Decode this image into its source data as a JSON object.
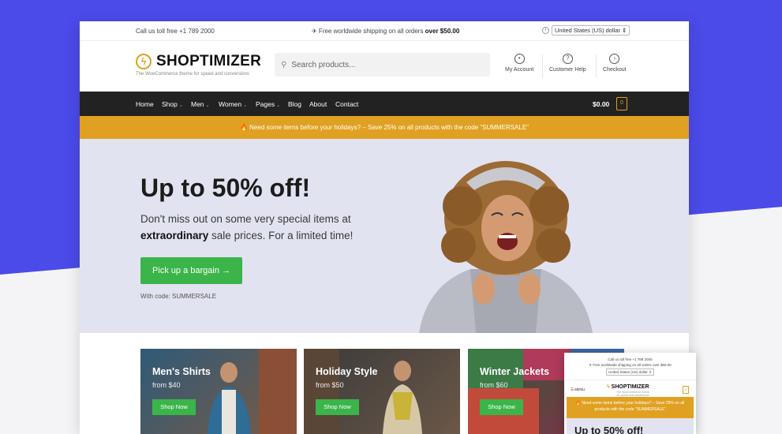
{
  "colors": {
    "brand_blue": "#4a4be8",
    "accent": "#e0a021",
    "green": "#3bb54a",
    "nav_bg": "#222222",
    "hero_bg": "#e2e3f0"
  },
  "topbar": {
    "phone": "Call us toll free +1 789 2000",
    "shipping_prefix": "✈ Free worldwide shipping on all orders ",
    "shipping_amount": "over $50.00",
    "currency": "United States (US) dollar ⇕"
  },
  "header": {
    "logo_text": "SHOPTIMIZER",
    "tagline": "The WooCommerce theme for speed and conversions",
    "search_placeholder": "Search products...",
    "links": {
      "account": "My Account",
      "help": "Customer Help",
      "checkout": "Checkout"
    }
  },
  "nav": {
    "items": [
      "Home",
      "Shop",
      "Men",
      "Women",
      "Pages",
      "Blog",
      "About",
      "Contact"
    ],
    "cart_total": "$0.00",
    "cart_count": "0"
  },
  "promo": "🔥 Need some items before your holidays? – Save 25% on all products with the code \"SUMMERSALE\"",
  "hero": {
    "title": "Up to 50% off!",
    "subtitle_1": "Don't miss out on some very special items at",
    "subtitle_bold": "extraordinary",
    "subtitle_2": " sale prices. For a limited time!",
    "button": "Pick up a bargain →",
    "code": "With code: SUMMERSALE"
  },
  "categories": [
    {
      "title": "Men's Shirts",
      "price": "from $40",
      "button": "Shop Now"
    },
    {
      "title": "Holiday Style",
      "price": "from $50",
      "button": "Shop Now"
    },
    {
      "title": "Winter Jackets",
      "price": "from $60",
      "button": "Shop Now"
    }
  ],
  "mobile": {
    "phone": "Call us toll free +1 789 2000",
    "shipping": "✈ Free worldwide shipping on all orders over $50.00",
    "currency": "United States (US) dollar ⇕",
    "menu": "MENU",
    "logo": "SHOPTIMIZER",
    "tagline": "The WooCommerce theme for speed and conversions",
    "cart_count": "0",
    "promo": "🔥 Need some items before your holidays? – Save 25% on all products with the code \"SUMMERSALE\"",
    "hero_title": "Up to 50% off!"
  }
}
